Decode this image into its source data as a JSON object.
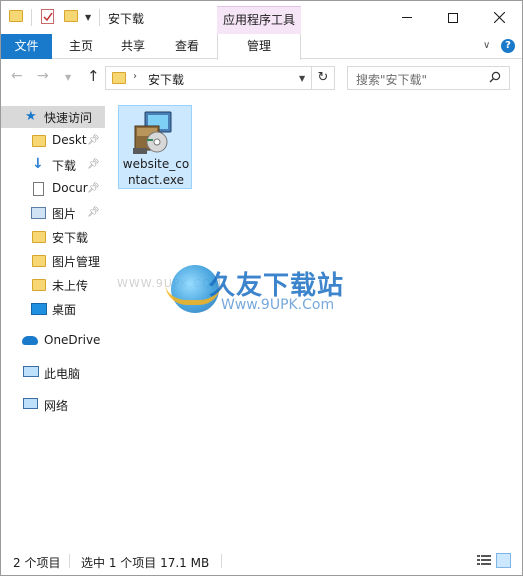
{
  "titlebar": {
    "title": "安下载",
    "contextual_tab": "应用程序工具"
  },
  "ribbon": {
    "tabs": [
      {
        "label": "文件"
      },
      {
        "label": "主页"
      },
      {
        "label": "共享"
      },
      {
        "label": "查看"
      },
      {
        "label": "管理"
      }
    ]
  },
  "address": {
    "path": "安下载",
    "search_placeholder": "搜索\"安下载\""
  },
  "sidebar": {
    "items": [
      {
        "label": "快速访问",
        "icon": "star-icon"
      },
      {
        "label": "Deskt",
        "icon": "folder-icon",
        "pinned": true
      },
      {
        "label": "下载",
        "icon": "download-icon",
        "pinned": true
      },
      {
        "label": "Docur",
        "icon": "document-icon",
        "pinned": true
      },
      {
        "label": "图片",
        "icon": "picture-icon",
        "pinned": true
      },
      {
        "label": "安下载",
        "icon": "folder-icon"
      },
      {
        "label": "图片管理",
        "icon": "folder-icon"
      },
      {
        "label": "未上传",
        "icon": "folder-icon"
      },
      {
        "label": "桌面",
        "icon": "desktop-icon"
      },
      {
        "label": "OneDrive",
        "icon": "cloud-icon"
      },
      {
        "label": "此电脑",
        "icon": "computer-icon"
      },
      {
        "label": "网络",
        "icon": "network-icon"
      }
    ]
  },
  "content": {
    "files": [
      {
        "name": "website_contact.exe",
        "icon": "installer-icon",
        "selected": true
      }
    ],
    "watermark": {
      "left_text": "WWW.9UPK.COM",
      "title": "久友下载站",
      "url": "Www.9UPK.Com"
    }
  },
  "status": {
    "item_count": "2 个项目",
    "selection": "选中 1 个项目  17.1 MB"
  },
  "colors": {
    "accent": "#1979ca",
    "selection": "#cce8ff",
    "contextual_tab": "#f5e5f7",
    "folder": "#f7d774"
  }
}
